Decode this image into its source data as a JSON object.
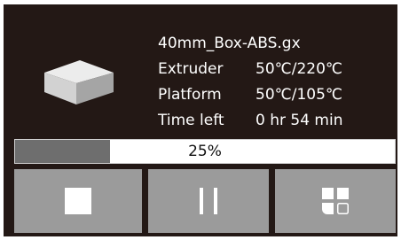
{
  "job": {
    "filename": "40mm_Box-ABS.gx",
    "rows": [
      {
        "label": "Extruder",
        "value": "50℃/220℃"
      },
      {
        "label": "Platform",
        "value": "50℃/105℃"
      },
      {
        "label": "Time left",
        "value": "0 hr 54 min"
      }
    ],
    "thumbnail_icon": "cube-icon"
  },
  "progress": {
    "label": "25%",
    "fraction": 0.25
  },
  "buttons": {
    "stop_icon": "stop-icon",
    "pause_icon": "pause-icon",
    "menu_icon": "app-grid-icon"
  },
  "colors": {
    "screen_bg": "#231815",
    "button_bg": "#9b9b9b",
    "progress_fill": "#6e6e6e",
    "progress_track": "#ffffff"
  }
}
